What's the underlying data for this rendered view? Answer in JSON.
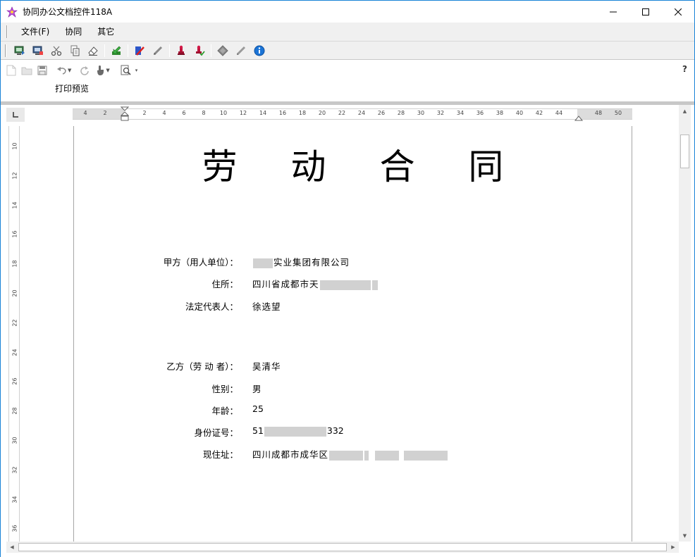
{
  "window": {
    "title": "协同办公文档控件118A"
  },
  "menu": {
    "items": [
      {
        "label": "文件(F)"
      },
      {
        "label": "协同"
      },
      {
        "label": "其它"
      }
    ]
  },
  "ribbon": {
    "print_preview_label": "打印预览",
    "help_label": "?"
  },
  "ruler": {
    "horizontal": [
      "4",
      "2",
      "2",
      "4",
      "6",
      "8",
      "10",
      "12",
      "14",
      "16",
      "18",
      "20",
      "22",
      "24",
      "26",
      "28",
      "30",
      "32",
      "34",
      "36",
      "38",
      "40",
      "42",
      "44",
      "48",
      "50"
    ],
    "vertical": [
      "10",
      "12",
      "14",
      "16",
      "18",
      "20",
      "22",
      "24",
      "26",
      "28",
      "30",
      "32",
      "34",
      "36"
    ]
  },
  "document": {
    "title": "劳 动 合 同",
    "party_a": {
      "employer_label": "甲方（用人单位）：",
      "employer_value": "实业集团有限公司",
      "address_label": "住所：",
      "address_value": "四川省成都市天",
      "rep_label": "法定代表人：",
      "rep_value": "徐选望"
    },
    "party_b": {
      "worker_label": "乙方（劳 动 者）：",
      "worker_value": "吴清华",
      "gender_label": "性别：",
      "gender_value": "男",
      "age_label": "年龄：",
      "age_value": "25",
      "id_label": "身份证号：",
      "id_prefix": "51",
      "id_suffix": "332",
      "current_address_label": "现住址：",
      "current_address_value": "四川成都市成华区"
    }
  }
}
